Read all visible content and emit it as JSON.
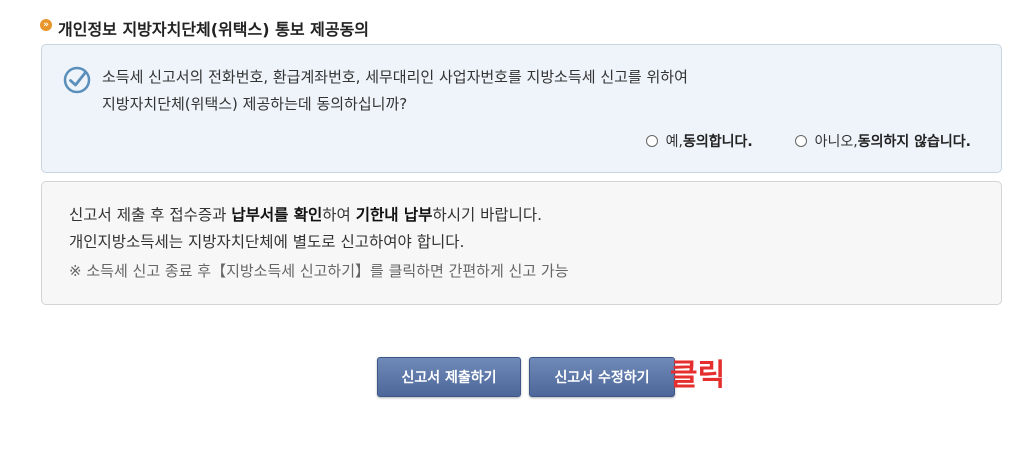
{
  "section": {
    "title": "개인정보 지방자치단체(위택스) 통보 제공동의"
  },
  "consent": {
    "question_line1": "소득세 신고서의 전화번호, 환급계좌번호, 세무대리인 사업자번호를 지방소득세 신고를 위하여",
    "question_line2": "지방자치단체(위택스) 제공하는데 동의하십니까?",
    "options": [
      {
        "prefix": "예, ",
        "bold": "동의합니다."
      },
      {
        "prefix": "아니오, ",
        "bold": "동의하지 않습니다."
      }
    ]
  },
  "notice": {
    "line1": {
      "t1": "신고서 제출 후 접수증과 ",
      "b1": "납부서를 확인",
      "t2": "하여 ",
      "b2": "기한내 납부",
      "t3": "하시기 바랍니다."
    },
    "line2": "개인지방소득세는 지방자치단체에 별도로 신고하여야 합니다.",
    "note_mark": "※",
    "note": "소득세 신고 종료 후【지방소득세 신고하기】를 클릭하면 간편하게 신고 가능"
  },
  "buttons": {
    "submit": "신고서 제출하기",
    "edit": "신고서 수정하기"
  },
  "annotation": {
    "click": "클릭"
  },
  "colors": {
    "accent": "#e8962b",
    "button": "#5873a6",
    "annotation": "#e52e2e"
  }
}
